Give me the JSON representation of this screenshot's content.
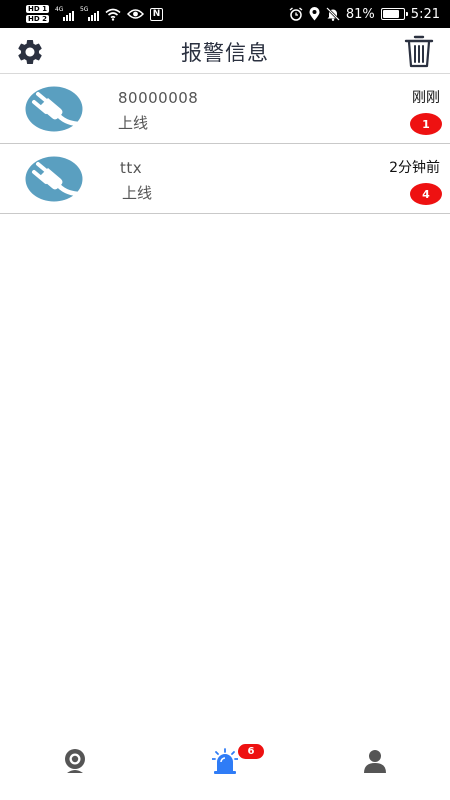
{
  "status_bar": {
    "hd_1": "HD 1",
    "hd_2": "HD 2",
    "sig1_label": "4G",
    "sig2_label": "5G",
    "nfc_label": "N",
    "battery_pct": "81%",
    "battery_level": 0.81,
    "time": "5:21"
  },
  "header": {
    "title": "报警信息",
    "settings_icon": "gear-icon",
    "delete_icon": "trash-icon"
  },
  "alarms": [
    {
      "name": "80000008",
      "status": "上线",
      "time": "刚刚",
      "count": "1",
      "icon": "power-plug-icon"
    },
    {
      "name": "ttx",
      "status": "上线",
      "time": "2分钟前",
      "count": "4",
      "icon": "power-plug-icon"
    }
  ],
  "bottom_nav": {
    "tabs": [
      {
        "icon": "camera-icon"
      },
      {
        "icon": "alarm-siren-icon",
        "badge": "6",
        "active": true
      },
      {
        "icon": "user-icon"
      }
    ]
  },
  "colors": {
    "accent": "#2f7cf6",
    "badge_red": "#ee1111",
    "plug_blue": "#5a9fc0",
    "nav_gray": "#555555",
    "title_text": "#2b3140"
  }
}
